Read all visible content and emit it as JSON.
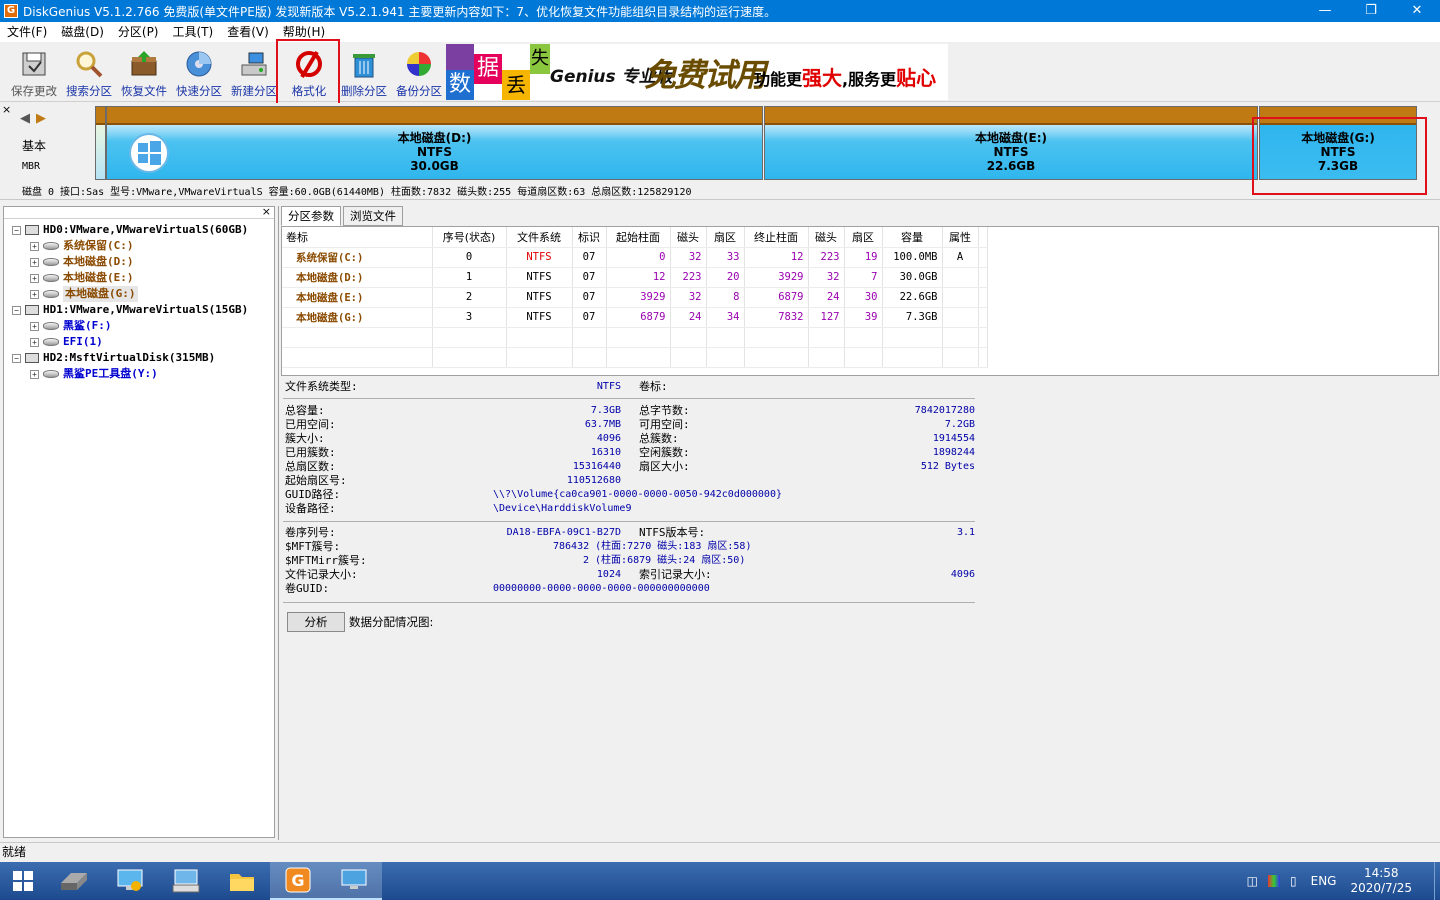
{
  "window": {
    "title": "DiskGenius V5.1.2.766 免费版(单文件PE版)    发现新版本 V5.2.1.941 主要更新内容如下：7、优化恢复文件功能组织目录结构的运行速度。",
    "app_icon_letter": "G"
  },
  "menu": [
    "文件(F)",
    "磁盘(D)",
    "分区(P)",
    "工具(T)",
    "查看(V)",
    "帮助(H)"
  ],
  "toolbar": {
    "save": "保存更改",
    "search": "搜索分区",
    "recover": "恢复文件",
    "quick": "快速分区",
    "new": "新建分区",
    "format": "格式化",
    "delete": "删除分区",
    "backup": "备份分区"
  },
  "banner": {
    "chars": [
      "数",
      "据",
      "丢",
      "失"
    ],
    "brand": "Genius 专业版",
    "slogan": "免费试用",
    "tagline_a": "功能更",
    "tagline_b": "强大",
    "tagline_c": ",服务更",
    "tagline_d": "贴心"
  },
  "diskbar": {
    "type": "基本",
    "scheme": "MBR",
    "partitions": [
      {
        "name": "本地磁盘(D:)",
        "fs": "NTFS",
        "size": "30.0GB"
      },
      {
        "name": "本地磁盘(E:)",
        "fs": "NTFS",
        "size": "22.6GB"
      },
      {
        "name": "本地磁盘(G:)",
        "fs": "NTFS",
        "size": "7.3GB"
      }
    ],
    "info": "磁盘 0 接口:Sas  型号:VMware,VMwareVirtualS  容量:60.0GB(61440MB)  柱面数:7832  磁头数:255  每道扇区数:63  总扇区数:125829120"
  },
  "tree": {
    "close": "×",
    "items": [
      {
        "label": "HD0:VMware,VMwareVirtualS(60GB)",
        "type": "disk"
      },
      {
        "label": "系统保留(C:)",
        "type": "part"
      },
      {
        "label": "本地磁盘(D:)",
        "type": "part"
      },
      {
        "label": "本地磁盘(E:)",
        "type": "part"
      },
      {
        "label": "本地磁盘(G:)",
        "type": "part"
      },
      {
        "label": "HD1:VMware,VMwareVirtualS(15GB)",
        "type": "disk"
      },
      {
        "label": "黑鲨(F:)",
        "type": "part"
      },
      {
        "label": "EFI(1)",
        "type": "part"
      },
      {
        "label": "HD2:MsftVirtualDisk(315MB)",
        "type": "disk"
      },
      {
        "label": "黑鲨PE工具盘(Y:)",
        "type": "part"
      }
    ]
  },
  "tabs": [
    "分区参数",
    "浏览文件"
  ],
  "ptable": {
    "headers": [
      "卷标",
      "序号(状态)",
      "文件系统",
      "标识",
      "起始柱面",
      "磁头",
      "扇区",
      "终止柱面",
      "磁头",
      "扇区",
      "容量",
      "属性"
    ],
    "rows": [
      [
        "系统保留(C:)",
        "0",
        "NTFS",
        "07",
        "0",
        "32",
        "33",
        "12",
        "223",
        "19",
        "100.0MB",
        "A"
      ],
      [
        "本地磁盘(D:)",
        "1",
        "NTFS",
        "07",
        "12",
        "223",
        "20",
        "3929",
        "32",
        "7",
        "30.0GB",
        ""
      ],
      [
        "本地磁盘(E:)",
        "2",
        "NTFS",
        "07",
        "3929",
        "32",
        "8",
        "6879",
        "24",
        "30",
        "22.6GB",
        ""
      ],
      [
        "本地磁盘(G:)",
        "3",
        "NTFS",
        "07",
        "6879",
        "24",
        "34",
        "7832",
        "127",
        "39",
        "7.3GB",
        ""
      ]
    ]
  },
  "details": {
    "fs_type_label": "文件系统类型:",
    "fs_type": "NTFS",
    "vol_label": "卷标:",
    "total_label": "总容量:",
    "total": "7.3GB",
    "bytes_label": "总字节数:",
    "bytes": "7842017280",
    "used_label": "已用空间:",
    "used": "63.7MB",
    "free_label": "可用空间:",
    "free": "7.2GB",
    "cluster_label": "簇大小:",
    "cluster": "4096",
    "clusters_label": "总簇数:",
    "clusters": "1914554",
    "used_cl_label": "已用簇数:",
    "used_cl": "16310",
    "free_cl_label": "空闲簇数:",
    "free_cl": "1898244",
    "sectors_label": "总扇区数:",
    "sectors": "15316440",
    "sector_size_label": "扇区大小:",
    "sector_size": "512 Bytes",
    "start_label": "起始扇区号:",
    "start": "110512680",
    "guid_path_label": "GUID路径:",
    "guid_path": "\\\\?\\Volume{ca0ca901-0000-0000-0050-942c0d000000}",
    "dev_path_label": "设备路径:",
    "dev_path": "\\Device\\HarddiskVolume9",
    "serial_label": "卷序列号:",
    "serial": "DA18-EBFA-09C1-B27D",
    "ntfs_ver_label": "NTFS版本号:",
    "ntfs_ver": "3.1",
    "mft_label": "$MFT簇号:",
    "mft": "786432 (柱面:7270 磁头:183 扇区:58)",
    "mftmirr_label": "$MFTMirr簇号:",
    "mftmirr": "2 (柱面:6879 磁头:24 扇区:50)",
    "rec_label": "文件记录大小:",
    "rec": "1024",
    "idx_label": "索引记录大小:",
    "idx": "4096",
    "vguid_label": "卷GUID:",
    "vguid": "00000000-0000-0000-0000-000000000000",
    "analyze": "分析",
    "dist_label": "数据分配情况图:"
  },
  "status": "就绪",
  "taskbar": {
    "lang": "ENG",
    "time": "14:58",
    "date": "2020/7/25"
  }
}
